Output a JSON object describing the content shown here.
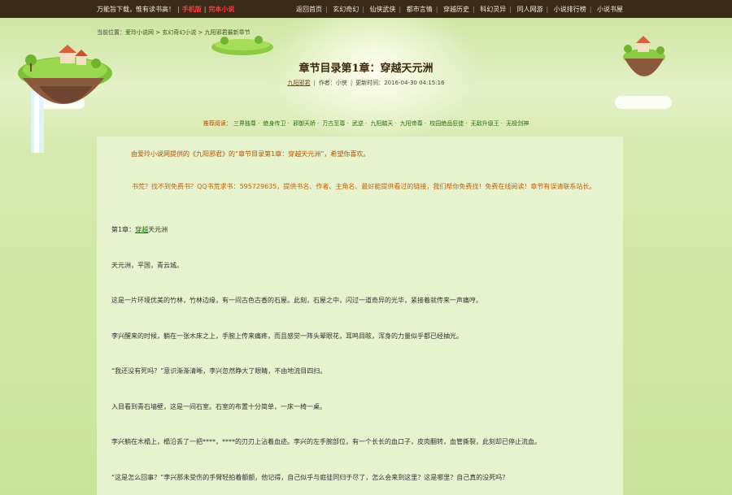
{
  "topbar": {
    "slogan": "万能旨下载，惟有读书高！",
    "link_hot": "手机版",
    "link_complete": "完本小说",
    "nav": [
      "返回首页",
      "玄幻奇幻",
      "仙侠武侠",
      "都市言情",
      "穿越历史",
      "科幻灵异",
      "同人网游",
      "小说排行榜",
      "小说书屋"
    ]
  },
  "breadcrumb": {
    "prefix": "当前位置：",
    "items": [
      "爱玲小说网",
      "玄幻奇幻小说",
      "九阳邪君最新章节"
    ]
  },
  "chapter": {
    "title": "章节目录第1章：穿越天元洲",
    "author": "九阳邪君",
    "author_label": "作者：小侠",
    "updated": "更新时间：2016-04-30 04:15:16"
  },
  "recommend": {
    "label": "推荐阅读：",
    "books": [
      "三界独尊",
      "绝身传卫",
      "邪御天娇",
      "万古至尊",
      "武逆",
      "九阳踏天",
      "九阳帝尊",
      "校园绝品狂徒",
      "无敌升级王",
      "无极剑神"
    ]
  },
  "intro": "由爱玲小说网提供的《九阳邪君》的“章节目录第1章：穿越天元洲”，希望你喜欢。",
  "notice": "书荒？找不到免费书？QQ书荒求书：595729635，提供书名、作者、主角名、最好能提供看过的链接，我们帮你免费找！免费在线阅读！章节有误请联系站长。",
  "paragraphs": [
    {
      "before": "第1章：",
      "kw": "穿越",
      "after": "天元洲"
    },
    {
      "before": "天元洲，平国，青云城。",
      "kw": "",
      "after": ""
    },
    {
      "before": "这是一片环境优美的竹林，竹林边缘，有一间古色古香的石屋。此刻，石屋之中，闪过一道奇异的光华，紧接着就传来一声痛哼。",
      "kw": "",
      "after": ""
    },
    {
      "before": "李兴醒来的时候，躺在一张木床之上，手腕上传来痛疼，而且感觉一阵头晕眼花，耳鸣目眩，浑身的力量似乎都已经抽光。",
      "kw": "",
      "after": ""
    },
    {
      "before": "“我还没有死吗？”意识渐渐清晰，李兴忽然睁大了眼睛，不由地流目四扫。",
      "kw": "",
      "after": ""
    },
    {
      "before": "入目看到青石墙壁，这是一间石室。石室的布置十分简单，一床一椅一桌。",
      "kw": "",
      "after": ""
    },
    {
      "before": "李兴躺在木榻上，榻沿丢了一把****，****的刃刃上沾着血迹。李兴的左手腕部位，有一个长长的血口子，皮肉翻转，血管撕裂，此刻却已停止流血。",
      "kw": "",
      "after": ""
    },
    {
      "before": "“这是怎么回事？”李兴那未受伤的手臂轻拍着额额，他记得，自己似乎与庭徒同归于尽了，怎么会来到这里？这是哪里？自己真的没死吗？",
      "kw": "",
      "after": ""
    }
  ]
}
